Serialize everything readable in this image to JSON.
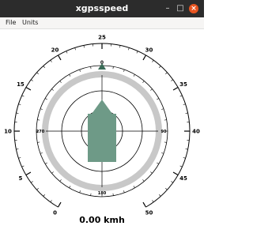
{
  "window": {
    "title": "xgpsspeed",
    "minimize_glyph": "–",
    "maximize_glyph": "□",
    "close_glyph": "×",
    "close_color": "#e95420"
  },
  "menu": {
    "items": [
      "File",
      "Units"
    ]
  },
  "speedometer": {
    "tick_labels": [
      "0",
      "5",
      "10",
      "15",
      "20",
      "25",
      "30",
      "35",
      "40",
      "45",
      "50"
    ],
    "min": 0,
    "max": 50,
    "current_speed": 0.0,
    "speed_text": "0.00 kmh"
  },
  "compass": {
    "labels": [
      "0",
      "90",
      "180",
      "270"
    ],
    "heading": 0,
    "ring_color": "#c8c8c8",
    "arrow_color": "#6e9a87"
  }
}
